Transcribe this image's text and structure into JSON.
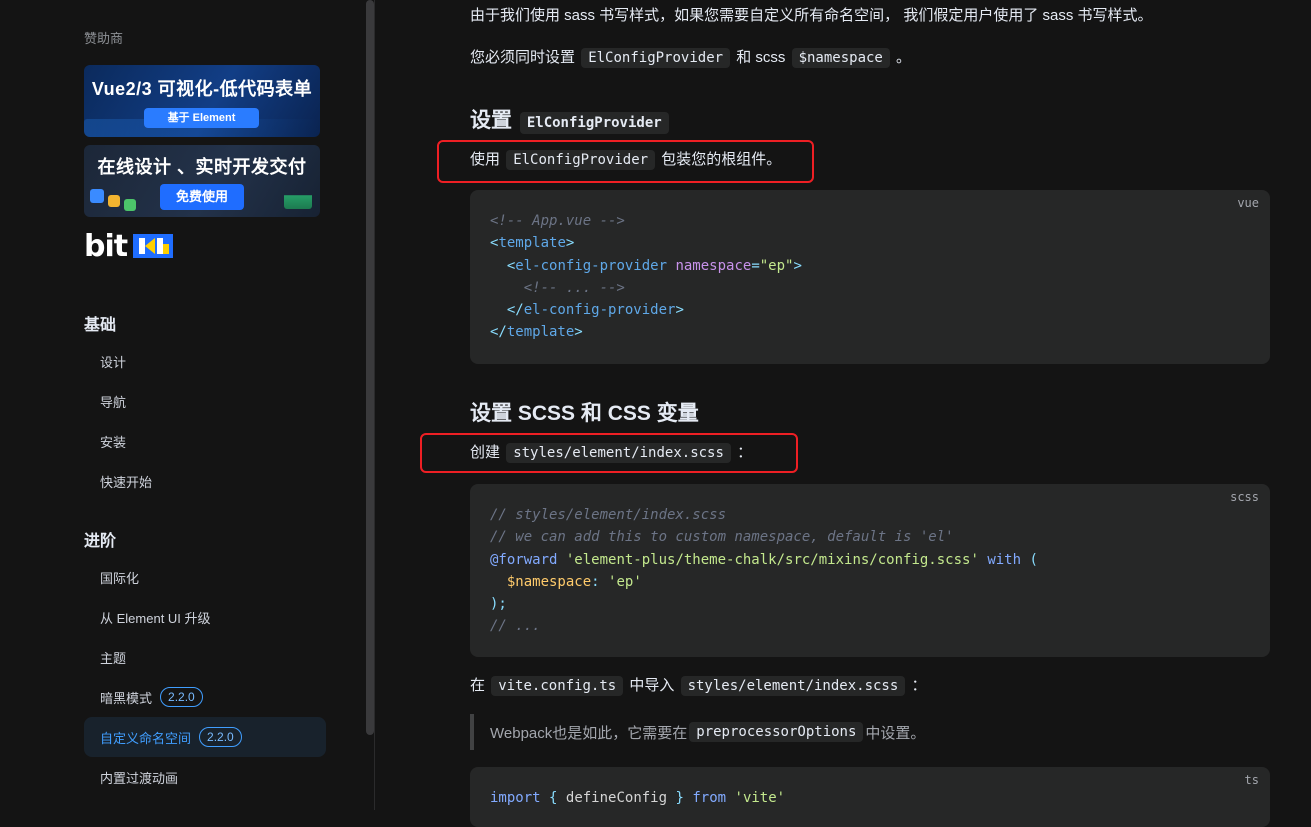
{
  "sidebar": {
    "sponsor_title": "赞助商",
    "ads": [
      {
        "title": "Vue2/3 可视化-低代码表单",
        "button": "基于 Element"
      },
      {
        "title": "在线设计 、实时开发交付",
        "button": "免费使用"
      }
    ],
    "bit_logo_text": "bit",
    "groups": [
      {
        "label": "基础"
      },
      {
        "label": "进阶"
      }
    ],
    "basic_items": [
      "设计",
      "导航",
      "安装",
      "快速开始"
    ],
    "advanced_items": [
      {
        "label": "国际化"
      },
      {
        "label": "从 Element UI 升级"
      },
      {
        "label": "主题"
      },
      {
        "label": "暗黑模式",
        "badge": "2.2.0"
      },
      {
        "label": "自定义命名空间",
        "badge": "2.2.0",
        "active": true
      },
      {
        "label": "内置过渡动画"
      }
    ]
  },
  "content": {
    "intro": "由于我们使用 sass 书写样式，如果您需要自定义所有命名空间， 我们假定用户使用了 sass 书写样式。",
    "must_set": {
      "pre": "您必须同时设置",
      "code1": "ElConfigProvider",
      "mid": "和 scss",
      "code2": "$namespace",
      "post": "。"
    },
    "h_config": {
      "pre": "设置",
      "code": "ElConfigProvider"
    },
    "use_config": {
      "pre": "使用",
      "code": "ElConfigProvider",
      "post": "包装您的根组件。"
    },
    "code_vue": {
      "lang": "vue",
      "lines": [
        "<!-- App.vue -->",
        "<template>",
        "  <el-config-provider namespace=\"ep\">",
        "    <!-- ... -->",
        "  </el-config-provider>",
        "</template>"
      ]
    },
    "h_scss": "设置 SCSS 和 CSS 变量",
    "create": {
      "pre": "创建",
      "code": "styles/element/index.scss",
      "post": "："
    },
    "code_scss": {
      "lang": "scss",
      "lines": [
        "// styles/element/index.scss",
        "// we can add this to custom namespace, default is 'el'",
        "@forward 'element-plus/theme-chalk/src/mixins/config.scss' with (",
        "  $namespace: 'ep'",
        ");",
        "// ..."
      ]
    },
    "import_in": {
      "pre": "在",
      "code1": "vite.config.ts",
      "mid": "中导入",
      "code2": "styles/element/index.scss",
      "post": "："
    },
    "blockquote": {
      "pre": "Webpack也是如此，它需要在",
      "code": "preprocessorOptions",
      "post": "中设置。"
    },
    "code_ts": {
      "lang": "ts",
      "lines": [
        "import { defineConfig } from 'vite'"
      ]
    }
  },
  "colors": {
    "background": "#141414",
    "accent": "#409eff",
    "highlight_box": "#ee1f24"
  }
}
